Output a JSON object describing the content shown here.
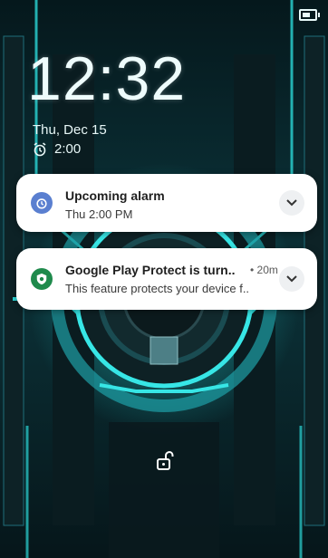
{
  "status": {
    "battery_icon": "battery-icon"
  },
  "lockscreen": {
    "time": "12:32",
    "date": "Thu, Dec 15",
    "next_alarm": "2:00"
  },
  "notifications": [
    {
      "app_icon": "alarm-clock-icon",
      "title": "Upcoming alarm",
      "text": "Thu 2:00 PM"
    },
    {
      "app_icon": "shield-icon",
      "title": "Google Play Protect is turn..",
      "time": "• 20m",
      "text": "This feature protects your device f.."
    }
  ],
  "bottom": {
    "unlock_icon": "unlock-icon"
  },
  "colors": {
    "accent_cyan": "#29e0e0",
    "notification_bg": "#ffffff",
    "alarm_icon_bg": "#5a7fd0",
    "protect_icon_bg": "#1f8a4c"
  }
}
